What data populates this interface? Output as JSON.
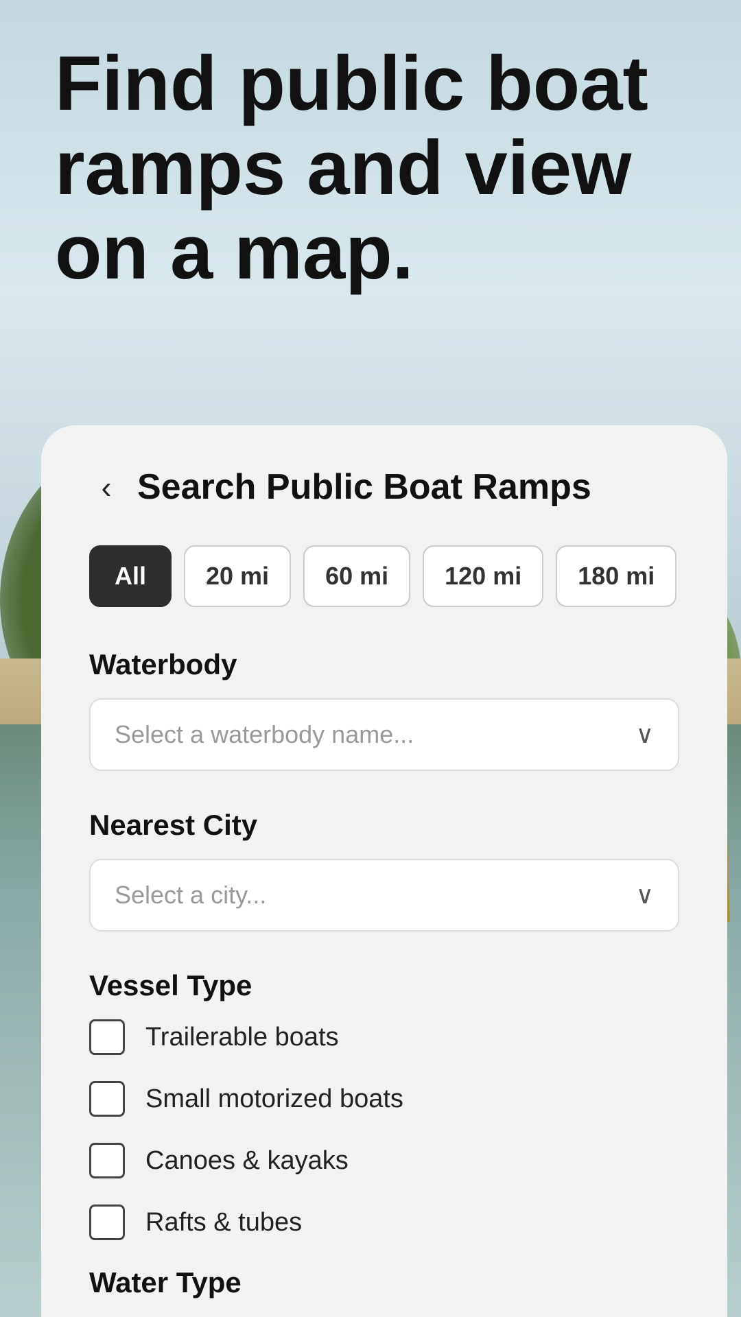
{
  "hero": {
    "headline": "Find public boat ramps and view on a map."
  },
  "card": {
    "back_label": "‹",
    "title": "Search Public Boat Ramps",
    "distance_filters": [
      {
        "label": "All",
        "active": true
      },
      {
        "label": "20 mi",
        "active": false
      },
      {
        "label": "60 mi",
        "active": false
      },
      {
        "label": "120 mi",
        "active": false
      },
      {
        "label": "180 mi",
        "active": false
      }
    ],
    "waterbody": {
      "label": "Waterbody",
      "placeholder": "Select a waterbody name...",
      "chevron": "⌄"
    },
    "nearest_city": {
      "label": "Nearest City",
      "placeholder": "Select a city...",
      "chevron": "⌄"
    },
    "vessel_type": {
      "label": "Vessel Type",
      "items": [
        {
          "label": "Trailerable boats",
          "checked": false
        },
        {
          "label": "Small motorized boats",
          "checked": false
        },
        {
          "label": "Canoes & kayaks",
          "checked": false
        },
        {
          "label": "Rafts & tubes",
          "checked": false
        }
      ]
    },
    "water_type_label": "Water Type"
  },
  "colors": {
    "active_filter_bg": "#2d2d2d",
    "active_filter_text": "#ffffff",
    "card_bg": "#f2f2f2"
  }
}
